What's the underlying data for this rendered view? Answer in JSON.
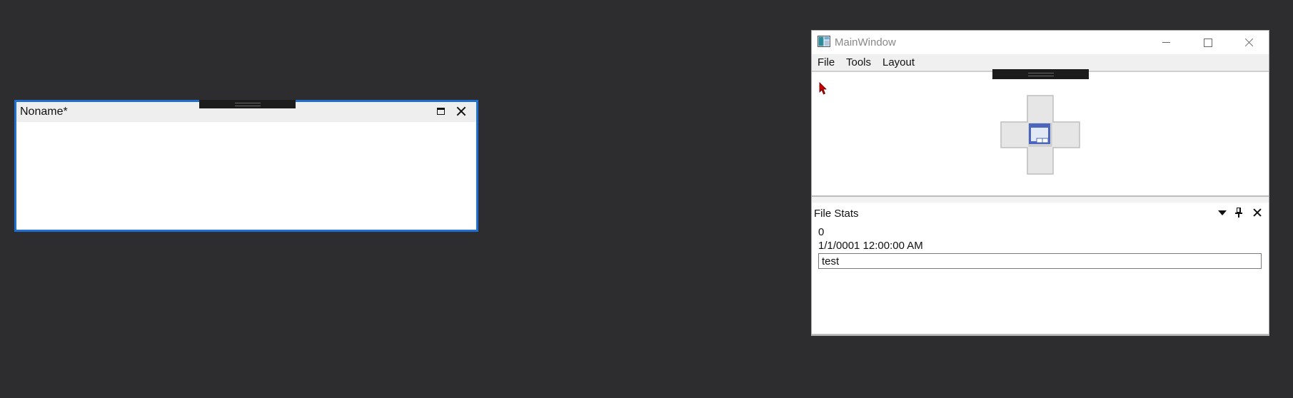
{
  "floating_window": {
    "title": "Noname*",
    "maximize_icon": "maximize-icon",
    "close_icon": "close-icon"
  },
  "main_window": {
    "title": "MainWindow",
    "app_icon": "window-app-icon",
    "caption_buttons": [
      "minimize-icon",
      "maximize-icon",
      "close-icon"
    ],
    "menu": [
      "File",
      "Tools",
      "Layout"
    ],
    "dock_guide_icon": "dock-center-icon",
    "cursor_icon": "cursor-arrow-icon"
  },
  "file_stats": {
    "title": "File Stats",
    "buttons": [
      "dropdown-icon",
      "pin-icon",
      "close-icon"
    ],
    "size": "0",
    "date": "1/1/0001 12:00:00 AM",
    "text_value": "test"
  },
  "colors": {
    "desktop": "#2d2d30",
    "active_border": "#1f6fd0",
    "grip": "#1c1c1c",
    "cursor": "#cc0000"
  }
}
